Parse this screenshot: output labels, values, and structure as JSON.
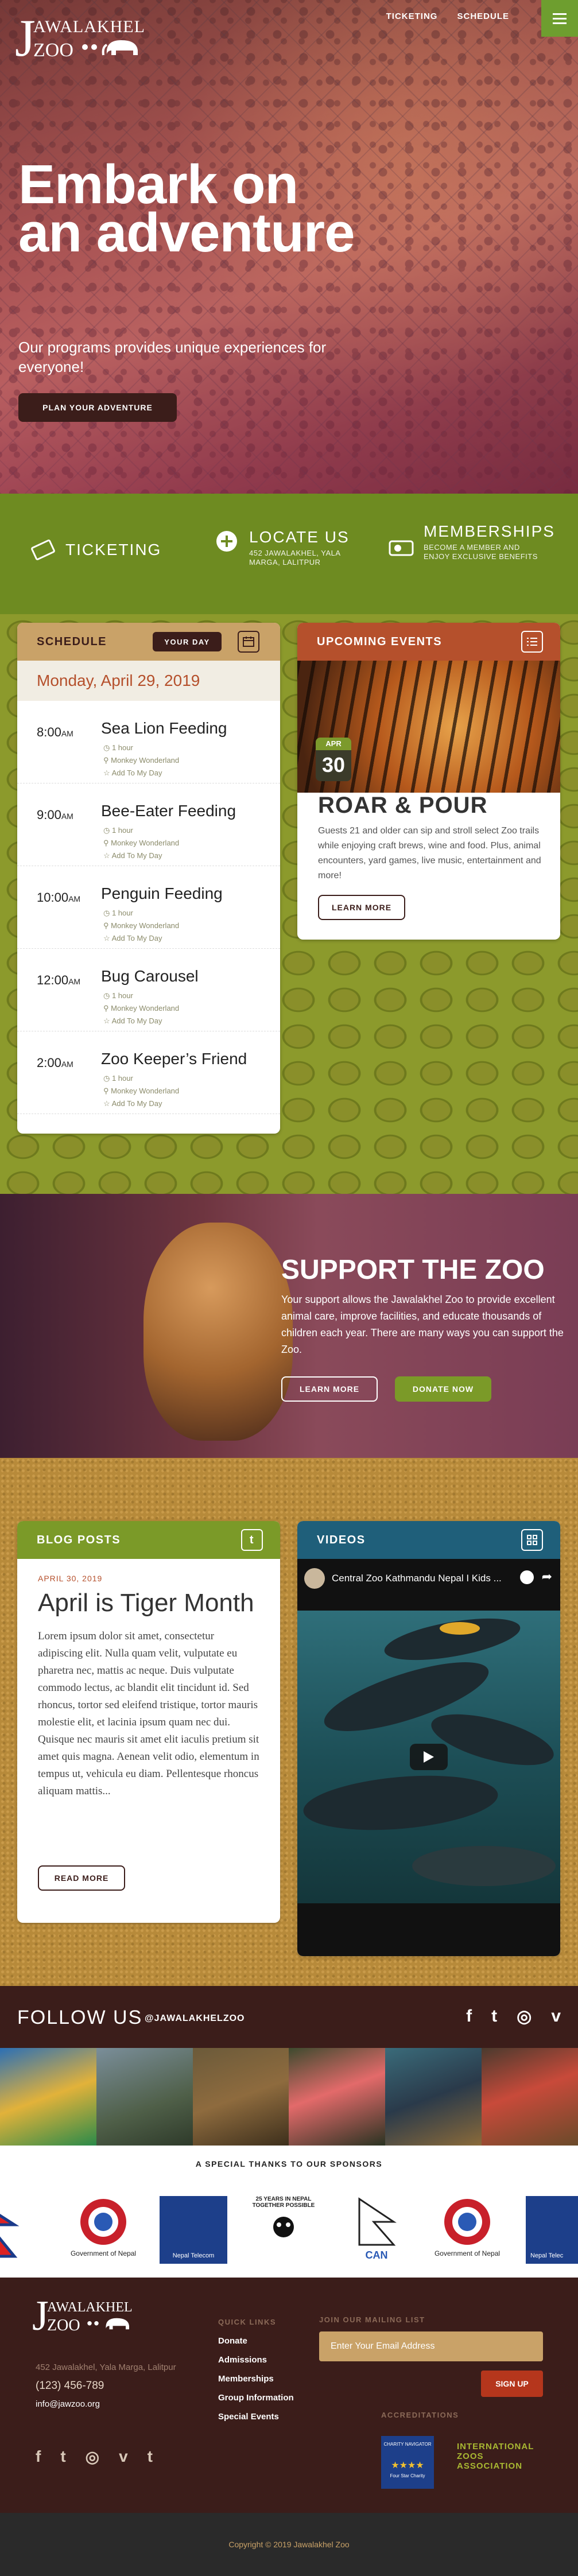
{
  "header": {
    "logo_top": "AWALAKHEL",
    "logo_bottom": "ZOO",
    "logo_initial": "J",
    "nav": [
      "TICKETING",
      "SCHEDULE"
    ]
  },
  "hero": {
    "title": "Embark on an adventure",
    "subtitle": "Our programs provides unique experiences for everyone!",
    "cta": "PLAN YOUR ADVENTURE"
  },
  "info": {
    "ticketing": "TICKETING",
    "locate_title": "LOCATE US",
    "locate_sub": "452 JAWALAKHEL, YALA MARGA, LALITPUR",
    "member_title": "MEMBERSHIPS",
    "member_sub": "BECOME A MEMBER AND ENJOY EXCLUSIVE BENEFITS"
  },
  "schedule": {
    "title": "SCHEDULE",
    "toggle": "YOUR DAY",
    "date": "Monday, April 29, 2019",
    "add": "Add To My Day",
    "events": [
      {
        "time": "8:00",
        "ampm": "AM",
        "name": "Sea Lion Feeding",
        "duration": "1 hour",
        "place": "Monkey Wonderland"
      },
      {
        "time": "9:00",
        "ampm": "AM",
        "name": "Bee-Eater Feeding",
        "duration": "1 hour",
        "place": "Monkey Wonderland"
      },
      {
        "time": "10:00",
        "ampm": "AM",
        "name": "Penguin Feeding",
        "duration": "1 hour",
        "place": "Monkey Wonderland"
      },
      {
        "time": "12:00",
        "ampm": "AM",
        "name": "Bug Carousel",
        "duration": "1 hour",
        "place": "Monkey Wonderland"
      },
      {
        "time": "2:00",
        "ampm": "AM",
        "name": "Zoo Keeper’s Friend",
        "duration": "1 hour",
        "place": "Monkey Wonderland"
      }
    ]
  },
  "upcoming": {
    "title": "UPCOMING EVENTS",
    "month": "APR",
    "day": "30",
    "event_title": "ROAR & POUR",
    "text": "Guests 21 and older can sip and stroll select Zoo trails while enjoying craft brews, wine and food. Plus, animal encounters, yard games, live music, entertainment and more!",
    "cta": "LEARN MORE"
  },
  "support": {
    "title": "SUPPORT THE ZOO",
    "text": "Your support allows the Jawalakhel Zoo to provide excellent animal care, improve facilities, and educate thousands of children each year. There are many ways you can support the Zoo.",
    "learn": "LEARN MORE",
    "donate": "DONATE NOW"
  },
  "blog": {
    "title": "BLOG POSTS",
    "icon": "t",
    "date": "APRIL 30, 2019",
    "post_title": "April is Tiger Month",
    "text": "Lorem ipsum dolor sit amet, consectetur adipiscing elit. Nulla quam velit, vulputate eu pharetra nec, mattis ac neque. Duis vulputate commodo lectus, ac blandit elit tincidunt id. Sed rhoncus, tortor sed eleifend tristique, tortor mauris molestie elit, et lacinia ipsum quam nec dui. Quisque nec mauris sit amet elit iaculis pretium sit amet quis magna. Aenean velit odio, elementum in tempus ut, vehicula eu diam. Pellentesque rhoncus aliquam mattis...",
    "cta": "READ MORE"
  },
  "videos": {
    "title": "VIDEOS",
    "video_title": "Central Zoo Kathmandu Nepal I Kids ..."
  },
  "follow": {
    "title": "FOLLOW US",
    "handle": "@JAWALAKHELZOO",
    "icons": [
      "f",
      "t",
      "◎",
      "v"
    ]
  },
  "sponsors": {
    "title": "A SPECIAL THANKS TO OUR SPONSORS",
    "items": [
      "Government of Nepal",
      "Nepal Telecom",
      "25 YEARS IN NEPAL TOGETHER POSSIBLE",
      "CAN",
      "Government of Nepal",
      "Nepal Telec"
    ]
  },
  "footer": {
    "logo_top": "AWALAKHEL",
    "logo_bottom": "ZOO",
    "logo_initial": "J",
    "address": "452 Jawalakhel, Yala Marga, Lalitpur",
    "phone": "(123) 456-789",
    "email": "info@jawzoo.org",
    "quick_title": "QUICK LINKS",
    "quick": [
      "Donate",
      "Admissions",
      "Memberships",
      "Group Information",
      "Special Events"
    ],
    "mailing_title": "JOIN OUR MAILING LIST",
    "email_placeholder": "Enter Your Email Address",
    "signup": "SIGN UP",
    "accred_title": "ACCREDITATIONS",
    "accred_badge": "CHARITY NAVIGATOR",
    "accred_stars": "★★★★",
    "accred_sub": "Four Star Charity",
    "accred_org": "INTERNATIONAL ZOOS ASSOCIATION",
    "social": [
      "f",
      "t",
      "◎",
      "v",
      "t"
    ],
    "copyright": "Copyright © 2019 Jawalakhel Zoo"
  }
}
